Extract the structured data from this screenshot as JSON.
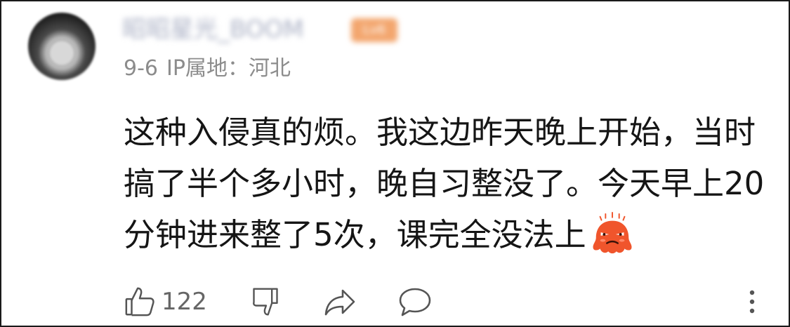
{
  "comment": {
    "user": {
      "name": "昭昭星光_BOOM",
      "badge": "Lv6"
    },
    "date": "9-6",
    "ip_location": "IP属地：河北",
    "content_lines": [
      "这种入侵真的烦。我这边昨天晚上开始，当时",
      "搞了半个多小时，晚自习整没了。今天早上20",
      "分钟进来整了5次，课完全没法上"
    ],
    "emoji_name": "angry-blob-emoji",
    "actions": {
      "like_count": "122"
    }
  },
  "colors": {
    "text": "#151515",
    "meta": "#8c8c8c",
    "icon": "#555555",
    "badge": "#f3a66e",
    "emoji": "#f0552c"
  }
}
